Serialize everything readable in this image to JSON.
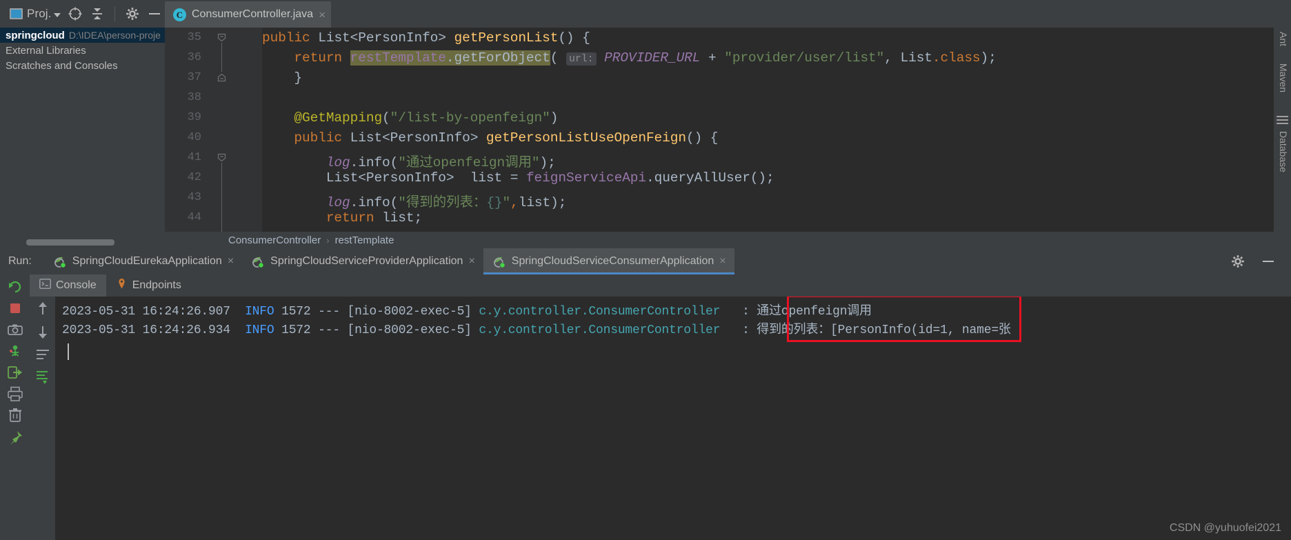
{
  "toolbar": {
    "project_label": "Proj.",
    "icons": [
      "project-panel-icon",
      "locate-icon",
      "collapse-all-icon",
      "settings-gear-icon",
      "hide-icon"
    ]
  },
  "editor_tab": {
    "filename": "ConsumerController.java",
    "icon": "java-class-icon",
    "close_label": "×"
  },
  "project_panel": {
    "rows": [
      {
        "name": "springcloud",
        "path": "D:\\IDEA\\person-proje",
        "selected": true
      },
      {
        "name": "External Libraries",
        "path": "",
        "selected": false
      },
      {
        "name": "Scratches and Consoles",
        "path": "",
        "selected": false
      }
    ]
  },
  "editor": {
    "line_numbers": [
      "35",
      "36",
      "37",
      "38",
      "39",
      "40",
      "41",
      "42",
      "43",
      "44"
    ],
    "inlay_hint": "url:",
    "lines": {
      "l35": "public List<PersonInfo> getPersonList() {",
      "l36": "return restTemplate.getForObject( url: PROVIDER_URL + \"provider/user/list\", List.class);",
      "l37": "}",
      "l38": "",
      "l39": "@GetMapping(\"/list-by-openfeign\")",
      "l40": "public List<PersonInfo> getPersonListUseOpenFeign() {",
      "l41": "log.info(\"通过openfeign调用\");",
      "l42": "List<PersonInfo>  list = feignServiceApi.queryAllUser();",
      "l43": "log.info(\"得到的列表：{}\",list);",
      "l44": "return list;"
    },
    "tok": {
      "kw_public": "public",
      "kw_return": "return",
      "type_list": "List",
      "generic_person": "<PersonInfo>",
      "m_getPersonList": "getPersonList",
      "m_getPersonListUseOpenFeign": "getPersonListUseOpenFeign",
      "f_restTemplate": "restTemplate",
      "m_getForObject": ".getForObject",
      "c_provider_url": "PROVIDER_URL",
      "s_provider_path": "\"provider/user/list\"",
      "list_class": "List",
      "dot_class": ".class",
      "anno_getmapping": "@GetMapping",
      "s_mapping_path": "\"/list-by-openfeign\"",
      "f_log": "log",
      "m_info": ".info",
      "s_log1": "\"通过openfeign调用\"",
      "s_log2_a": "\"得到的列表：",
      "s_log2_fmt": "{}",
      "s_log2_b": "\"",
      "f_feignServiceApi": "feignServiceApi",
      "m_queryAllUser": ".queryAllUser",
      "v_list": "list",
      "plus": "+",
      "eq": "="
    }
  },
  "breadcrumb": {
    "items": [
      "ConsumerController",
      "restTemplate"
    ],
    "separator": "›"
  },
  "run_window": {
    "label": "Run:",
    "tabs": [
      {
        "name": "SpringCloudEurekaApplication",
        "active": false,
        "close": "×"
      },
      {
        "name": "SpringCloudServiceProviderApplication",
        "active": false,
        "close": "×"
      },
      {
        "name": "SpringCloudServiceConsumerApplication",
        "active": true,
        "close": "×"
      }
    ],
    "header_icons": [
      "settings-gear-icon",
      "hide-icon"
    ]
  },
  "console_tabs": [
    {
      "label": "Console",
      "icon": "console-icon",
      "active": true
    },
    {
      "label": "Endpoints",
      "icon": "endpoints-icon",
      "active": false
    }
  ],
  "console_toolbar_left": [
    "rerun-icon",
    "stop-icon",
    "screenshot-camera-icon",
    "thread-dump-icon",
    "attach-debugger-icon",
    "print-icon",
    "trash-icon",
    "pin-icon"
  ],
  "console_toolbar_second": [
    "scroll-up-icon",
    "scroll-down-icon",
    "soft-wrap-icon",
    "scroll-to-end-icon"
  ],
  "console_log": [
    {
      "time": "2023-05-31 16:24:26.907",
      "level": "INFO",
      "pid": "1572",
      "dashes": "---",
      "thread": "[nio-8002-exec-5]",
      "logger": "c.y.controller.ConsumerController",
      "sep": ":",
      "message": "通过openfeign调用"
    },
    {
      "time": "2023-05-31 16:24:26.934",
      "level": "INFO",
      "pid": "1572",
      "dashes": "---",
      "thread": "[nio-8002-exec-5]",
      "logger": "c.y.controller.ConsumerController",
      "sep": ":",
      "message": "得到的列表：[PersonInfo(id=1, name=张"
    }
  ],
  "annotation": {
    "type": "red-rectangle-highlight",
    "color": "#e81123"
  },
  "right_strip": {
    "items": [
      "Ant",
      "Maven",
      "Database"
    ]
  },
  "watermark": "CSDN @yuhuofei2021",
  "colors": {
    "editor_bg": "#2b2b2b",
    "panel_bg": "#3c3f41",
    "gutter_bg": "#313335",
    "tab_active": "#4e5254",
    "accent_blue": "#4a88c7",
    "keyword_orange": "#cc7832",
    "string_green": "#6a8759",
    "field_purple": "#9876aa",
    "method_yellow": "#ffc66d",
    "annotation_yellow": "#bbb529",
    "logger_teal": "#46a5b0",
    "info_blue": "#499dff",
    "highlight_olive": "#6b6b40",
    "selection_navy": "#0d293e",
    "red_box": "#e81123"
  }
}
